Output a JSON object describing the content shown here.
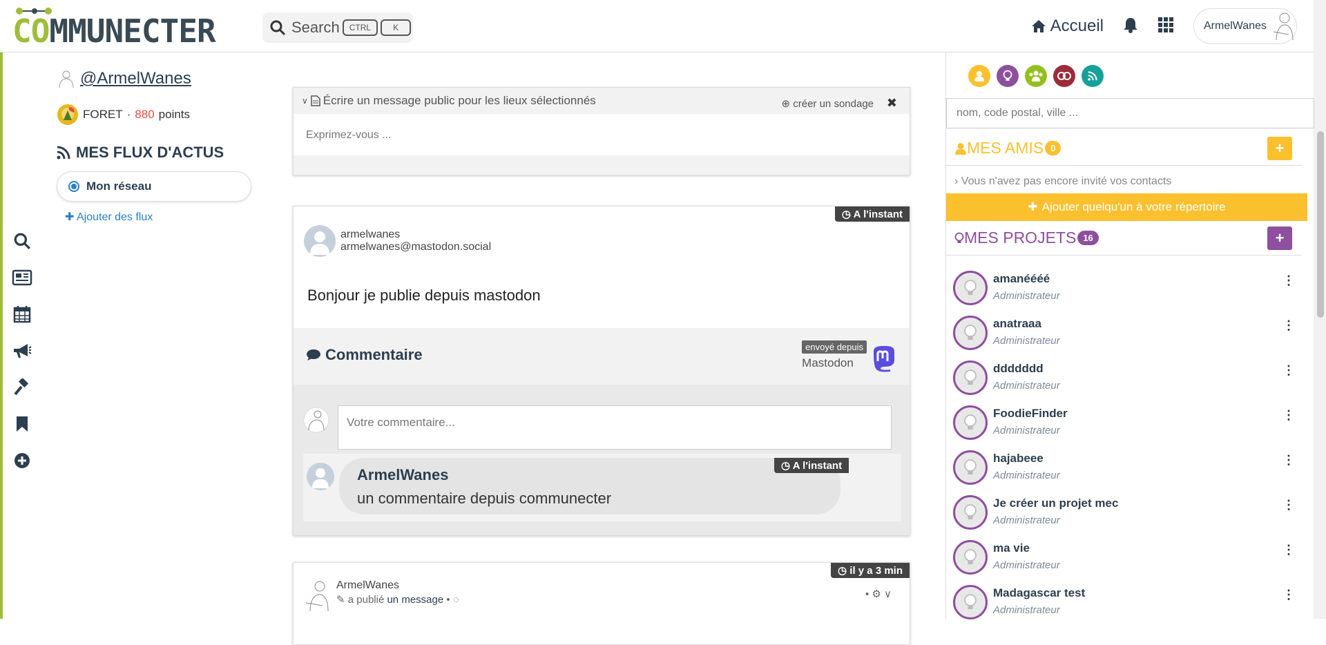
{
  "header": {
    "logo_text": "COMMUNECTER",
    "search_label": "Search",
    "kbd_ctrl": "CTRL",
    "kbd_k": "K",
    "home_label": "Accueil",
    "user_name": "ArmelWanes"
  },
  "profile": {
    "handle": "@ArmelWanes",
    "level": "FORET",
    "points_value": "880",
    "points_label": "points",
    "separator": "·"
  },
  "flux": {
    "title": "MES FLUX D'ACTUS",
    "option": "Mon réseau",
    "add_label": "Ajouter des flux"
  },
  "composer": {
    "header": "Écrire un message public pour les lieux sélectionnés",
    "poll_label": "créer un sondage",
    "placeholder": "Exprimez-vous ..."
  },
  "post1": {
    "timestamp": "A l'instant",
    "author_name": "armelwanes",
    "author_handle": "armelwanes@mastodon.social",
    "text": "Bonjour je publie depuis mastodon",
    "comment_label": "Commentaire",
    "sent_from_label": "envoyé depuis",
    "source": "Mastodon",
    "comment_placeholder": "Votre commentaire...",
    "comment": {
      "author": "ArmelWanes",
      "text": "un commentaire depuis communecter",
      "timestamp": "A l'instant"
    }
  },
  "post2": {
    "timestamp": "il y a 3 min",
    "author": "ArmelWanes",
    "action": "a publié",
    "object": "un message",
    "bullet": "•"
  },
  "right": {
    "search_placeholder": "nom, code postal, ville ...",
    "friends_title": "MES AMIS",
    "friends_count": "0",
    "friends_color": "#fbc02d",
    "invite_text": "Vous n'avez pas encore invité vos contacts",
    "add_contact": "Ajouter quelqu'un à votre répertoire",
    "projects_title": "MES PROJETS",
    "projects_count": "16",
    "projects_color": "#8e4f9e",
    "projects": [
      {
        "name": "amanéééé",
        "role": "Administrateur"
      },
      {
        "name": "anatraaa",
        "role": "Administrateur"
      },
      {
        "name": "ddddddd",
        "role": "Administrateur"
      },
      {
        "name": "FoodieFinder",
        "role": "Administrateur"
      },
      {
        "name": "hajabeee",
        "role": "Administrateur"
      },
      {
        "name": "Je créer un projet mec",
        "role": "Administrateur"
      },
      {
        "name": "ma vie",
        "role": "Administrateur"
      },
      {
        "name": "Madagascar test",
        "role": "Administrateur"
      }
    ]
  },
  "colors": {
    "brand_green": "#9fbd38",
    "brand_dark": "#3a4a55",
    "link_blue": "#2a7fc6",
    "points_red": "#e74c3c",
    "filter_person": "#fbc02d",
    "filter_project": "#8e4f9e",
    "filter_group": "#93c020",
    "filter_event": "#9c2c3a",
    "filter_rss": "#16a09a",
    "mastodon": "#5b4ede"
  }
}
